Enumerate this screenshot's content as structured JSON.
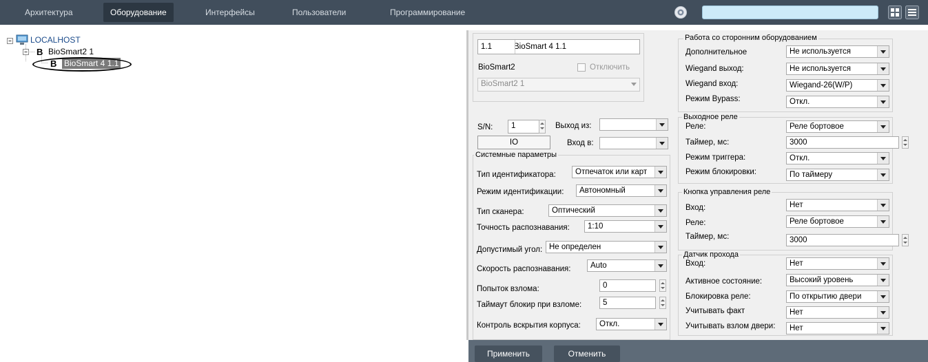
{
  "topbar": {
    "tabs": [
      "Архитектура",
      "Оборудование",
      "Интерфейсы",
      "Пользователи",
      "Программирование"
    ],
    "active_tab": "Оборудование",
    "search": {
      "value": "",
      "placeholder": ""
    },
    "icons": [
      "logo-icon",
      "grid-view-icon",
      "menu-icon"
    ]
  },
  "tree": {
    "root": {
      "icon": "computer-icon",
      "label": "LOCALHOST"
    },
    "child": {
      "icon_letter": "B",
      "label": "BioSmart2 1"
    },
    "grandchild": {
      "icon_letter": "B",
      "label": "BioSmart 4 1.1"
    }
  },
  "object_info": {
    "id": "1.1",
    "name": "BioSmart 4 1.1",
    "parent_type": "BioSmart2",
    "disable_label": "Отключить",
    "parent_select": "BioSmart2 1"
  },
  "device": {
    "sn_label": "S/N:",
    "sn_value": "1",
    "output_from_label": "Выход из:",
    "output_from_value": "",
    "io_button": "IO",
    "input_to_label": "Вход в:",
    "input_to_value": ""
  },
  "system_params": {
    "title": "Системные параметры",
    "identifier_type": {
      "label": "Тип идентификатора:",
      "value": "Отпечаток или карт"
    },
    "identification_mode": {
      "label": "Режим идентификации:",
      "value": "Автономный"
    },
    "scanner_type": {
      "label": "Тип сканера:",
      "value": "Оптический"
    },
    "recognition_accuracy": {
      "label": "Точность распознавания:",
      "value": "1:10"
    },
    "allowed_angle": {
      "label": "Допустимый угол:",
      "value": "Не определен"
    },
    "recognition_speed": {
      "label": "Скорость распознавания:",
      "value": "Auto"
    },
    "hack_attempts": {
      "label": "Попыток взлома:",
      "value": "0"
    },
    "block_timeout": {
      "label": "Таймаут блокир при взломе:",
      "value": "5"
    },
    "case_open_control": {
      "label": "Контроль вскрытия корпуса:",
      "value": "Откл."
    }
  },
  "third_party": {
    "title": "Работа со сторонним оборудованием",
    "additional": {
      "label": "Дополнительное",
      "value": "Не используется"
    },
    "wiegand_out": {
      "label": "Wiegand выход:",
      "value": "Не используется"
    },
    "wiegand_in": {
      "label": "Wiegand вход:",
      "value": "Wiegand-26(W/P)"
    },
    "bypass_mode": {
      "label": "Режим Bypass:",
      "value": "Откл."
    }
  },
  "output_relay": {
    "title": "Выходное реле",
    "relay": {
      "label": "Реле:",
      "value": "Реле бортовое"
    },
    "timer": {
      "label": "Таймер, мс:",
      "value": "3000"
    },
    "trigger_mode": {
      "label": "Режим триггера:",
      "value": "Откл."
    },
    "lock_mode": {
      "label": "Режим блокировки:",
      "value": "По таймеру"
    }
  },
  "relay_button": {
    "title": "Кнопка управления реле",
    "input": {
      "label": "Вход:",
      "value": "Нет"
    },
    "relay": {
      "label": "Реле:",
      "value": "Реле бортовое"
    },
    "timer": {
      "label": "Таймер, мс:",
      "value": "3000"
    }
  },
  "pass_sensor": {
    "title": "Датчик прохода",
    "input": {
      "label": "Вход:",
      "value": "Нет"
    },
    "active_state": {
      "label": "Активное состояние:",
      "value": "Высокий уровень"
    },
    "relay_lock": {
      "label": "Блокировка реле:",
      "value": "По открытию двери"
    },
    "consider_fact": {
      "label": "Учитывать факт",
      "value": "Нет"
    },
    "consider_break": {
      "label": "Учитывать взлом двери:",
      "value": "Нет"
    }
  },
  "footer": {
    "apply": "Применить",
    "cancel": "Отменить"
  },
  "colors": {
    "topbar": "#414e5c",
    "active_tab": "#2c3742",
    "search_bg": "#cdeaf8",
    "footer": "#5e6b78",
    "panel": "#f0f0f0"
  }
}
